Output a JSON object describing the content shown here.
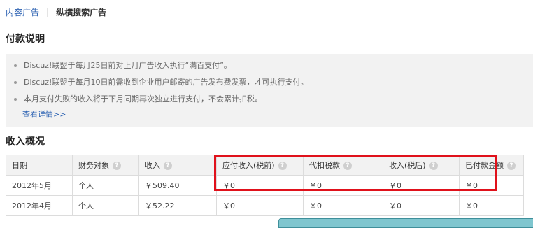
{
  "breadcrumb": {
    "link": "内容广告",
    "current": "纵横搜索广告"
  },
  "payment": {
    "title": "付款说明",
    "items": [
      "Discuz!联盟于每月25日前对上月广告收入执行“满百支付”。",
      "Discuz!联盟于每月10日前需收到企业用户邮寄的广告发布费发票，才可执行支付。",
      "本月支付失败的收入将于下月同期再次独立进行支付，不会累计扣税。"
    ],
    "detail_link": "查看详情>>"
  },
  "income": {
    "title": "收入概况",
    "columns": [
      "日期",
      "财务对象",
      "收入",
      "应付收入(税前)",
      "代扣税款",
      "收入(税后)",
      "已付款金额"
    ],
    "rows": [
      [
        "2012年5月",
        "个人",
        "￥509.40",
        "￥0",
        "￥0",
        "￥0",
        "￥0"
      ],
      [
        "2012年4月",
        "个人",
        "￥52.22",
        "￥0",
        "￥0",
        "￥0",
        "￥0"
      ]
    ]
  },
  "colors": {
    "link": "#2b61b2",
    "highlight": "#e0111b",
    "panel": "#f2f2f2"
  },
  "icons": {
    "help": "question-circle-icon"
  }
}
